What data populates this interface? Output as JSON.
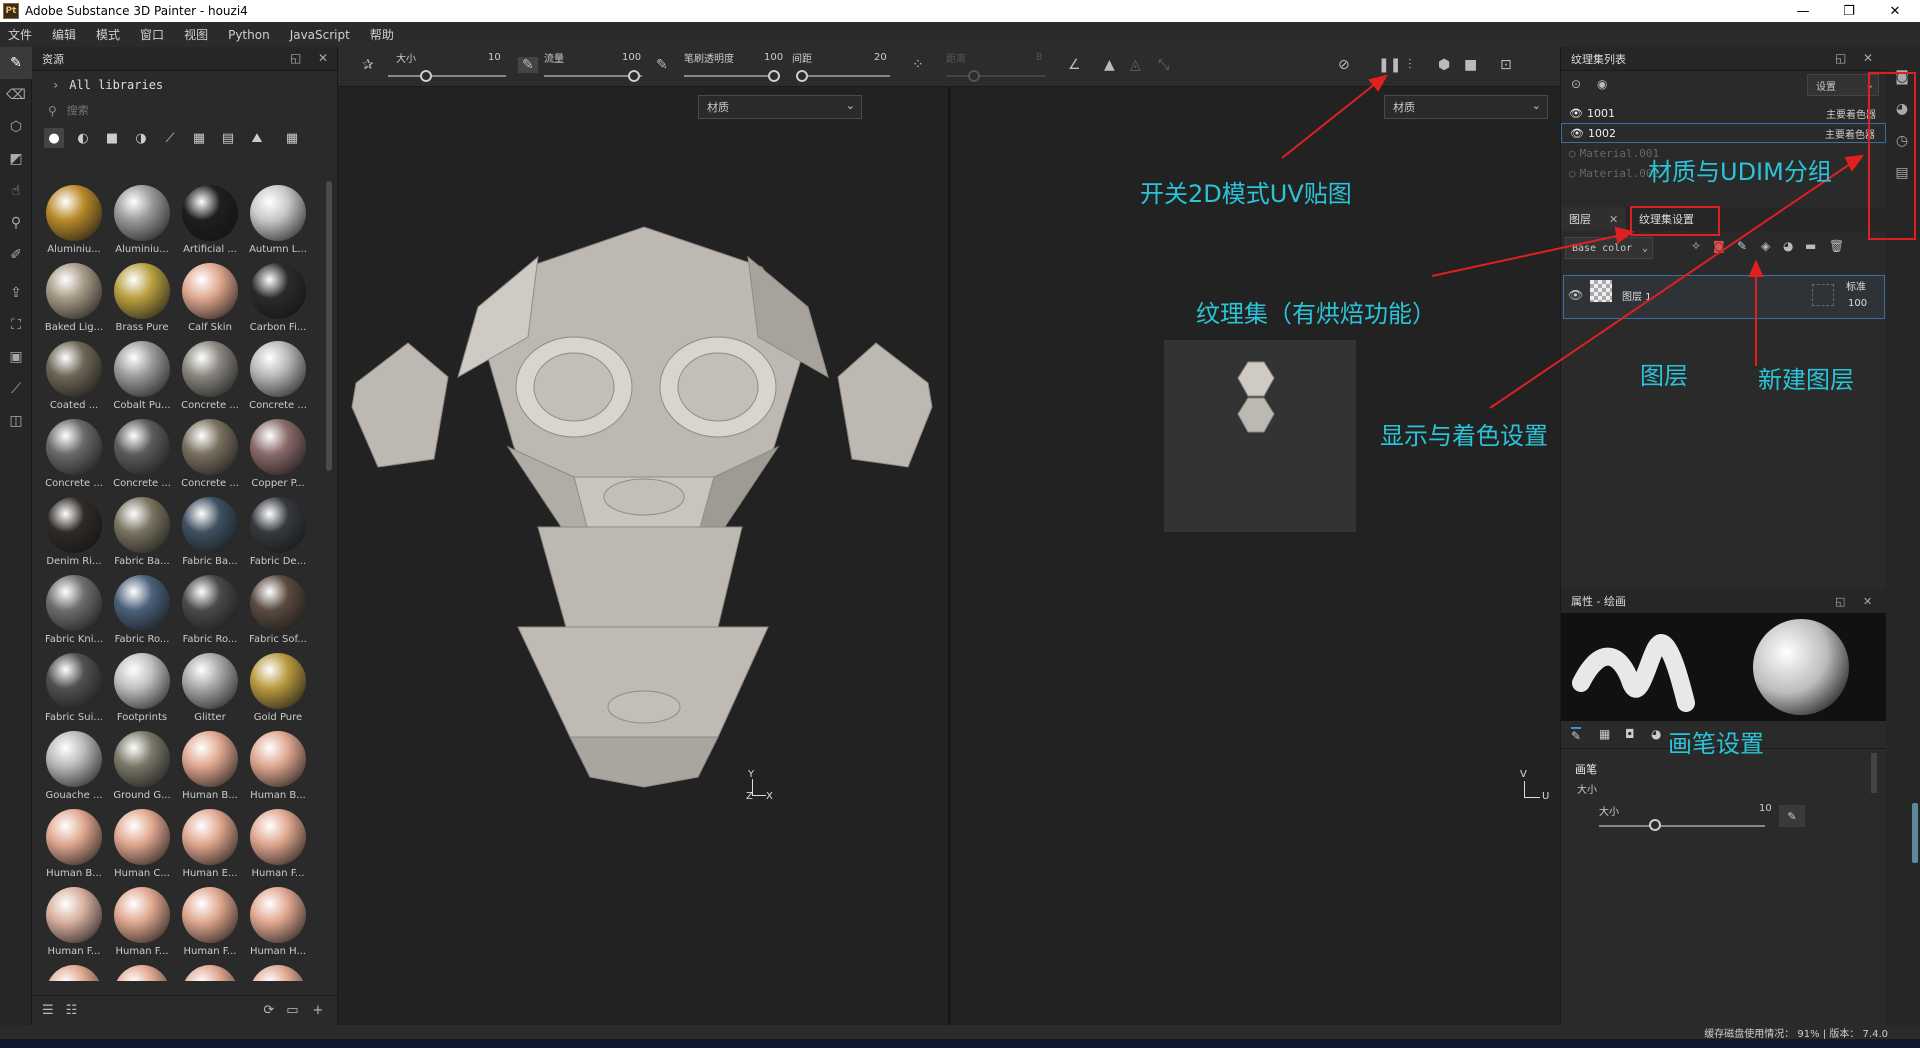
{
  "window": {
    "title": "Adobe Substance 3D Painter - houzi4",
    "app_icon_text": "Pt",
    "controls": [
      "—",
      "❐",
      "✕"
    ]
  },
  "menu": [
    "文件",
    "编辑",
    "模式",
    "窗口",
    "视图",
    "Python",
    "JavaScript",
    "帮助"
  ],
  "assets_panel": {
    "title": "资源",
    "library": "All libraries",
    "search_placeholder": "搜索",
    "materials": [
      {
        "label": "Aluminiu...",
        "color": "#b88a2a"
      },
      {
        "label": "Aluminiu...",
        "color": "#9a9a9a"
      },
      {
        "label": "Artificial ...",
        "color": "#1e1e1e"
      },
      {
        "label": "Autumn L...",
        "color": "#c8c8c8"
      },
      {
        "label": "Baked Lig...",
        "color": "#a89a88"
      },
      {
        "label": "Brass Pure",
        "color": "#b8a040"
      },
      {
        "label": "Calf Skin",
        "color": "#e0a890"
      },
      {
        "label": "Carbon Fi...",
        "color": "#2a2a2a"
      },
      {
        "label": "Coated ...",
        "color": "#6e6656"
      },
      {
        "label": "Cobalt Pu...",
        "color": "#9c9c9c"
      },
      {
        "label": "Concrete ...",
        "color": "#8a8680"
      },
      {
        "label": "Concrete ...",
        "color": "#b8b8b8"
      },
      {
        "label": "Concrete ...",
        "color": "#6a6a6a"
      },
      {
        "label": "Concrete ...",
        "color": "#5c5c5c"
      },
      {
        "label": "Concrete ...",
        "color": "#7a7060"
      },
      {
        "label": "Copper P...",
        "color": "#8a6a6a"
      },
      {
        "label": "Denim Ri...",
        "color": "#2e2a26"
      },
      {
        "label": "Fabric Ba...",
        "color": "#7a7460"
      },
      {
        "label": "Fabric Ba...",
        "color": "#3e5060"
      },
      {
        "label": "Fabric De...",
        "color": "#35393e"
      },
      {
        "label": "Fabric Kni...",
        "color": "#6e6e6e"
      },
      {
        "label": "Fabric Ro...",
        "color": "#4a607a"
      },
      {
        "label": "Fabric Ro...",
        "color": "#4a4a4a"
      },
      {
        "label": "Fabric Sof...",
        "color": "#5a4a40"
      },
      {
        "label": "Fabric Sui...",
        "color": "#505050"
      },
      {
        "label": "Footprints",
        "color": "#c0c0c0"
      },
      {
        "label": "Glitter",
        "color": "#a8a8a8"
      },
      {
        "label": "Gold Pure",
        "color": "#b89a40"
      },
      {
        "label": "Gouache ...",
        "color": "#bababa"
      },
      {
        "label": "Ground G...",
        "color": "#7a7868"
      },
      {
        "label": "Human B...",
        "color": "#e0a890"
      },
      {
        "label": "Human B...",
        "color": "#e0a890"
      },
      {
        "label": "Human B...",
        "color": "#e0a890"
      },
      {
        "label": "Human C...",
        "color": "#e0a890"
      },
      {
        "label": "Human E...",
        "color": "#e0a890"
      },
      {
        "label": "Human F...",
        "color": "#e0a890"
      },
      {
        "label": "Human F...",
        "color": "#d8b0a0"
      },
      {
        "label": "Human F...",
        "color": "#e0a890"
      },
      {
        "label": "Human F...",
        "color": "#e0a890"
      },
      {
        "label": "Human H...",
        "color": "#e0a890"
      },
      {
        "label": "",
        "color": "#e0a890"
      },
      {
        "label": "",
        "color": "#e0a890"
      },
      {
        "label": "",
        "color": "#e0a890"
      },
      {
        "label": "",
        "color": "#e0a890"
      }
    ]
  },
  "toolbar": {
    "size_label": "大小",
    "size_value": "10",
    "flow_label": "流量",
    "flow_value": "100",
    "opacity_label": "笔刷透明度",
    "opacity_value": "100",
    "spacing_label": "间距",
    "spacing_value": "20",
    "jitter_label": "距离",
    "jitter_value": "8"
  },
  "viewport3d": {
    "channel_select": "材质",
    "axis_x": "X",
    "axis_y": "Y",
    "axis_z": "Z"
  },
  "viewport2d": {
    "channel_select": "材质",
    "axis_u": "U",
    "axis_v": "V"
  },
  "texture_set_list": {
    "title": "纹理集列表",
    "settings_select": "设置",
    "rows": [
      {
        "name": "1001",
        "shader": "主要着色器"
      },
      {
        "name": "1002",
        "shader": "主要着色器"
      },
      {
        "name": "Material.001",
        "shader": ""
      },
      {
        "name": "Material.002",
        "shader": ""
      }
    ]
  },
  "layers": {
    "tab_layers": "图层",
    "tab_texture_settings": "纹理集设置",
    "channel_select": "Base color",
    "layer_name": "图层 1",
    "blend_mode": "标准",
    "opacity": "100"
  },
  "properties": {
    "title": "属性 - 绘画",
    "brush_section": "画笔",
    "size_label": "大小",
    "size_label2": "大小",
    "size_value": "10"
  },
  "annotations": {
    "uv_toggle": "开关2D模式UV贴图",
    "udim": "材质与UDIM分组",
    "texture_set": "纹理集（有烘焙功能）",
    "layers": "图层",
    "new_layer": "新建图层",
    "display": "显示与着色设置",
    "brush": "画笔设置"
  },
  "status": {
    "cache": "缓存磁盘使用情况：  91%  |  版本：  7.4.0"
  }
}
